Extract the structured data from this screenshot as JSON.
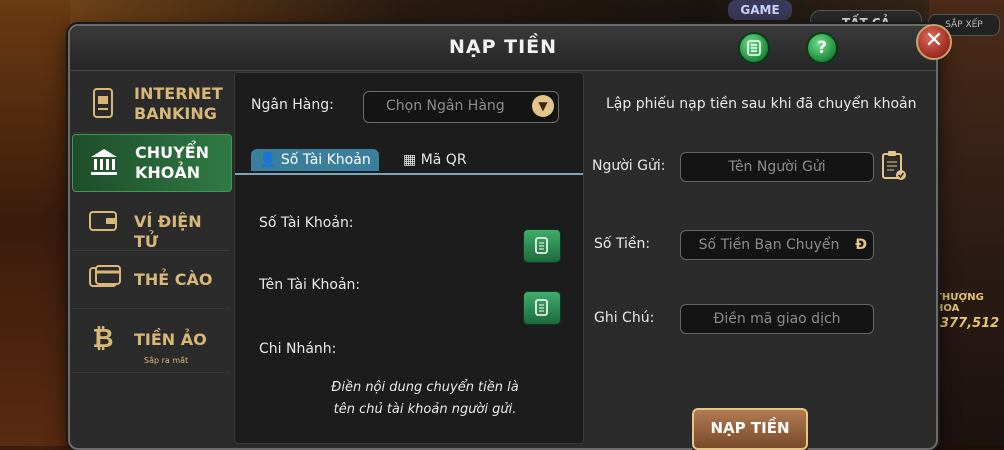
{
  "background": {
    "game_badge": "GAME",
    "filter_tab": "TẤT CẢ",
    "sort_label": "SẮP XẾP",
    "jackpot_number": "377,512",
    "jackpot_word": "THƯỢNG HOA"
  },
  "dialog": {
    "title": "NẠP TIỀN",
    "history_icon": "list-icon",
    "help_label": "?",
    "close_label": "✕"
  },
  "sidebar": {
    "items": [
      {
        "label": "INTERNET BANKING",
        "icon": "bank-card-icon",
        "active": false
      },
      {
        "label": "CHUYỂN KHOẢN",
        "icon": "bank-building-icon",
        "active": true
      },
      {
        "label": "VÍ ĐIỆN TỬ",
        "icon": "wallet-icon",
        "active": false
      },
      {
        "label": "THẺ CÀO",
        "icon": "scratch-card-icon",
        "active": false
      },
      {
        "label": "TIỀN ẢO",
        "icon": "bitcoin-icon",
        "active": false,
        "sub": "Sắp ra mắt"
      }
    ]
  },
  "bank_panel": {
    "bank_label": "Ngân Hàng:",
    "bank_select": "Chọn Ngân Hàng",
    "tabs": [
      {
        "label": "Số Tài Khoản",
        "active": true
      },
      {
        "label": "Mã QR",
        "active": false
      }
    ],
    "account_number_label": "Số Tài Khoản:",
    "account_name_label": "Tên Tài Khoản:",
    "branch_label": "Chi Nhánh:",
    "note_line1": "Điền nội dung chuyển tiền là",
    "note_line2": "tên chủ tài khoản người gửi."
  },
  "form": {
    "instruction": "Lập phiếu nạp tiền sau khi đã chuyển khoản",
    "sender_label": "Người Gửi:",
    "sender_placeholder": "Tên Người Gửi",
    "amount_label": "Số Tiền:",
    "amount_placeholder": "Số Tiền Bạn Chuyển",
    "currency_symbol": "Đ",
    "note_label": "Ghi Chú:",
    "note_placeholder": "Điền mã giao dịch",
    "submit_label": "NẠP TIỀN"
  },
  "colors": {
    "accent_green": "#2f7a44",
    "gold": "#d8b877",
    "tab_blue": "#3a7f9c"
  }
}
